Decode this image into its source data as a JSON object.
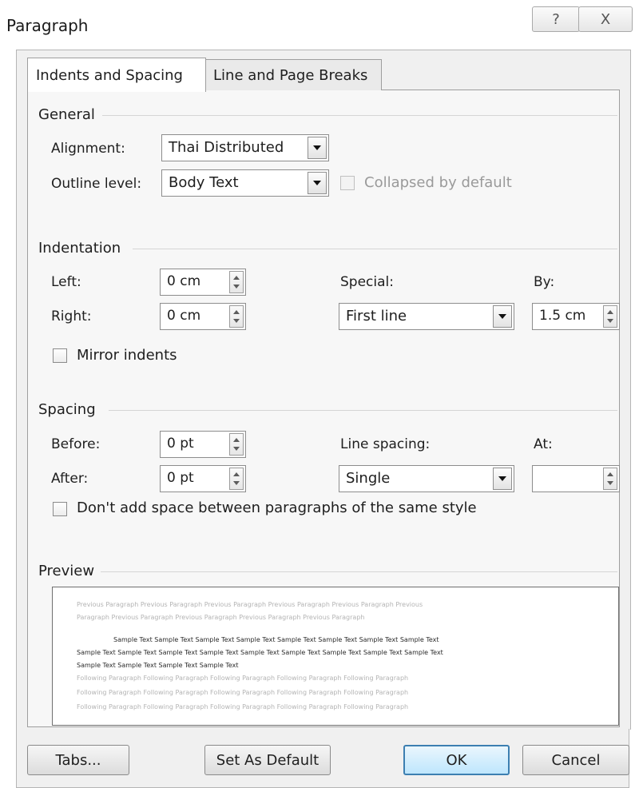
{
  "window": {
    "title": "Paragraph",
    "help_glyph": "?",
    "close_glyph": "X"
  },
  "tabs": [
    {
      "label": "Indents and Spacing",
      "mnemonic": "I",
      "active": true
    },
    {
      "label": "Line and Page Breaks",
      "mnemonic": "P",
      "active": false
    }
  ],
  "general": {
    "heading": "General",
    "alignment": {
      "label": "Alignment:",
      "value": "Thai Distributed"
    },
    "outline_level": {
      "label": "Outline level:",
      "value": "Body Text"
    },
    "collapsed": {
      "label": "Collapsed by default",
      "enabled": false
    }
  },
  "indentation": {
    "heading": "Indentation",
    "left": {
      "label": "Left:",
      "value": "0 cm"
    },
    "right": {
      "label": "Right:",
      "value": "0 cm"
    },
    "special": {
      "label": "Special:",
      "value": "First line"
    },
    "by": {
      "label": "By:",
      "value": "1.5 cm"
    },
    "mirror": {
      "label": "Mirror indents"
    }
  },
  "spacing": {
    "heading": "Spacing",
    "before": {
      "label": "Before:",
      "value": "0 pt"
    },
    "after": {
      "label": "After:",
      "value": "0 pt"
    },
    "line_spacing": {
      "label": "Line spacing:",
      "value": "Single"
    },
    "at": {
      "label": "At:",
      "value": ""
    },
    "dont_add": {
      "label": "Don't add space between paragraphs of the same style"
    }
  },
  "preview": {
    "heading": "Preview",
    "previous_1": "Previous Paragraph Previous Paragraph Previous Paragraph Previous Paragraph Previous Paragraph Previous",
    "previous_2": "Paragraph Previous Paragraph Previous Paragraph Previous Paragraph Previous Paragraph",
    "sample_1": "Sample Text Sample Text Sample Text Sample Text Sample Text Sample Text Sample Text Sample Text",
    "sample_2": "Sample Text Sample Text Sample Text Sample Text Sample Text Sample Text Sample Text Sample Text Sample Text",
    "sample_3": "Sample Text Sample Text Sample Text Sample Text",
    "following_1": "Following Paragraph Following Paragraph Following Paragraph Following Paragraph Following Paragraph",
    "following_2": "Following Paragraph Following Paragraph Following Paragraph Following Paragraph Following Paragraph",
    "following_3": "Following Paragraph Following Paragraph Following Paragraph Following Paragraph Following Paragraph"
  },
  "buttons": {
    "tabs": "Tabs...",
    "set_default": "Set As Default",
    "ok": "OK",
    "cancel": "Cancel"
  },
  "colors": {
    "ok_border": "#3c7fb1",
    "ok_fill": "#bee6fd",
    "preview_gray": "#b4b4b4"
  }
}
